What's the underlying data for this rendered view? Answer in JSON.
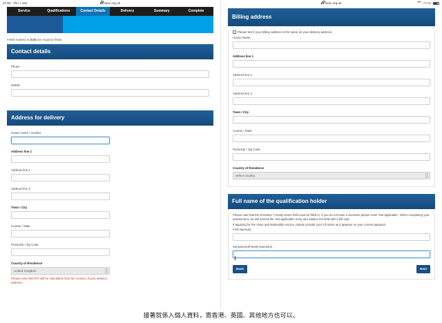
{
  "left": {
    "status_time": "21:58 · Thu 7 Jan",
    "url": "naric.org.uk",
    "steps": [
      "Service",
      "Qualifications",
      "Contact Details",
      "Delivery",
      "Summary",
      "Complete"
    ],
    "active_step": 2,
    "required_note_pre": "Fields marked in ",
    "required_note_bold": "bold",
    "required_note_post": " are required fields.",
    "contact": {
      "title": "Contact details",
      "phone_label": "Phone",
      "mobile_label": "Mobile"
    },
    "delivery": {
      "title": "Address for delivery",
      "house_label": "House name / number",
      "line1_label": "Address line 1",
      "line2_label": "Address line 2",
      "line3_label": "Address line 3",
      "town_label": "Town / City",
      "county_label": "County / State",
      "postcode_label": "Postcode / Zip Code",
      "country_label": "Country of Residence",
      "country_value": "United Kingdom",
      "vat_note": "Please note that VAT will be calculated from the country of your delivery address."
    }
  },
  "right": {
    "status_battery": "70%",
    "url": "naric.org.uk",
    "billing": {
      "title": "Billing address",
      "same_as_delivery": "Please tick if your billing address is the same as your delivery address",
      "house_label": "House Name",
      "line1_label": "Address line 1",
      "line2_label": "Address line 2",
      "line3_label": "Address line 3",
      "town_label": "Town / City",
      "county_label": "County / State",
      "postcode_label": "Postcode / Zip Code",
      "country_label": "Country of Residence",
      "country_placeholder": "select country"
    },
    "holder": {
      "title": "Full name of the qualification holder",
      "para1": "Please note that the Surname / Family Name field must be filled in. If you do not have a Surname please enter 'Not applicable'. When completing your assessment, we will amend the 'Not applicable' entry and replace the field with a full stop.",
      "para2": "If applying for the Visas and Nationality service, please provide your full name as it appears on your current passport.",
      "first_label": "First Name(s)",
      "surname_label": "Surname(s)/Family Names(s)"
    },
    "back_label": "Back",
    "next_label": "Next"
  },
  "caption": "接著就係入個人資料，寄香港、英國、其他地方也可以。"
}
